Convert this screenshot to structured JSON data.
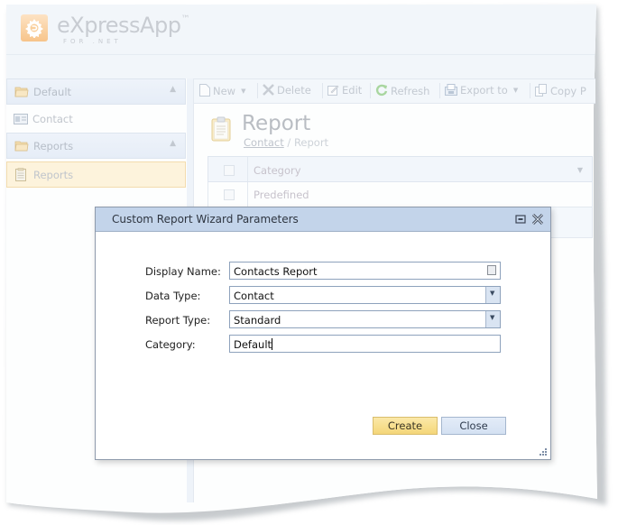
{
  "app": {
    "logo_text": "eXpressApp",
    "logo_tm": "™",
    "logo_subtitle": "FOR .NET"
  },
  "navigation": {
    "groups": [
      {
        "label": "Default",
        "icon": "folder-icon",
        "items": [
          {
            "label": "Contact",
            "icon": "contact-card-icon",
            "selected": false
          }
        ]
      },
      {
        "label": "Reports",
        "icon": "folder-icon",
        "items": [
          {
            "label": "Reports",
            "icon": "report-icon",
            "selected": true
          }
        ]
      }
    ]
  },
  "toolbar": {
    "new_label": "New",
    "delete_label": "Delete",
    "edit_label": "Edit",
    "refresh_label": "Refresh",
    "export_label": "Export to",
    "copy_label": "Copy P"
  },
  "view": {
    "title": "Report",
    "breadcrumb_link": "Contact",
    "breadcrumb_separator": " / ",
    "breadcrumb_current": "Report"
  },
  "grid": {
    "columns": [
      "Category"
    ],
    "rows": [
      {
        "category": "Predefined"
      }
    ]
  },
  "dialog": {
    "title": "Custom Report Wizard Parameters",
    "fields": [
      {
        "label": "Display Name:",
        "value": "Contacts Report",
        "type": "text-with-picker"
      },
      {
        "label": "Data Type:",
        "value": "Contact",
        "type": "dropdown"
      },
      {
        "label": "Report Type:",
        "value": "Standard",
        "type": "dropdown"
      },
      {
        "label": "Category:",
        "value": "Default",
        "type": "text"
      }
    ],
    "create_label": "Create",
    "close_label": "Close",
    "accent_create": "#f4d679",
    "header_color": "#c3d4ea"
  }
}
